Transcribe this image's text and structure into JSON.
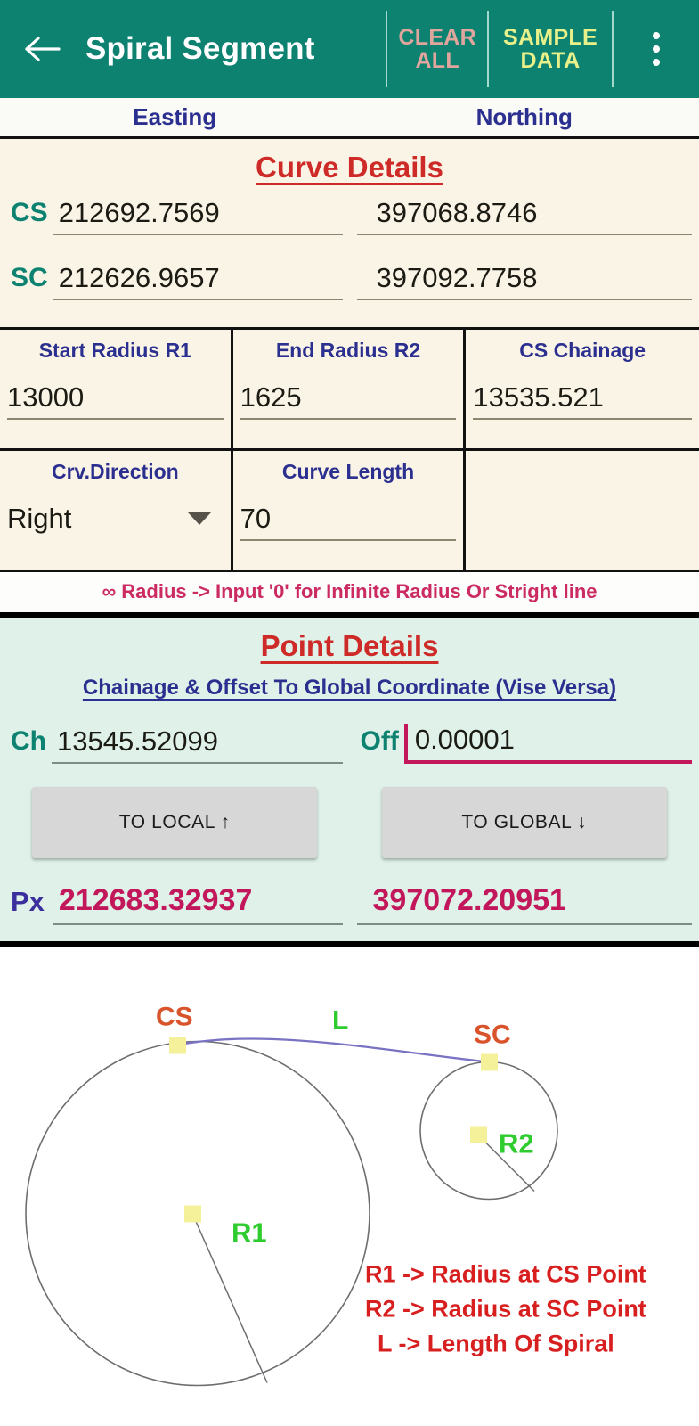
{
  "appbar": {
    "back_icon": "arrow-left-icon",
    "title": "Spiral Segment",
    "clear_all": "CLEAR\nALL",
    "clear_all_line1": "CLEAR",
    "clear_all_line2": "ALL",
    "sample_data_line1": "SAMPLE",
    "sample_data_line2": "DATA",
    "menu_icon": "overflow-menu-icon",
    "bg_color": "#0D8271",
    "clear_color": "#E0A59C",
    "sample_color": "#E8F08A"
  },
  "columns": {
    "easting": "Easting",
    "northing": "Northing"
  },
  "curve": {
    "title": "Curve Details",
    "title_color": "#CE2B28",
    "rows": [
      {
        "label": "CS",
        "easting": "212692.7569",
        "northing": "397068.8746"
      },
      {
        "label": "SC",
        "easting": "212626.9657",
        "northing": "397092.7758"
      }
    ],
    "fields": [
      {
        "label": "Start Radius R1",
        "value": "13000",
        "type": "text"
      },
      {
        "label": "End Radius R2",
        "value": "1625",
        "type": "text"
      },
      {
        "label": "CS Chainage",
        "value": "13535.521",
        "type": "text"
      },
      {
        "label": "Crv.Direction",
        "value": "Right",
        "type": "dropdown"
      },
      {
        "label": "Curve Length",
        "value": "70",
        "type": "text"
      },
      {
        "label": "",
        "value": "",
        "type": "empty"
      }
    ],
    "note": "∞ Radius -> Input '0' for Infinite Radius Or Stright line",
    "note_color": "#CB2A63"
  },
  "point": {
    "title": "Point Details",
    "subtitle": "Chainage & Offset To Global Coordinate (Vise Versa)",
    "ch_label": "Ch",
    "ch_value": "13545.52099",
    "off_label": "Off",
    "off_value": "0.00001",
    "to_local": "TO LOCAL ↑",
    "to_global": "TO GLOBAL ↓",
    "px_label": "Px",
    "px_easting": "212683.32937",
    "px_northing": "397072.20951",
    "bg_color": "#DFF1E9",
    "result_color": "#C2185B",
    "focus_color": "#C2185B"
  },
  "diagram": {
    "label_cs": "CS",
    "label_sc": "SC",
    "label_l": "L",
    "label_r1": "R1",
    "label_r2": "R2",
    "legend": [
      "R1 -> Radius at CS Point",
      "R2 -> Radius at SC Point",
      " L   -> Length Of Spiral"
    ],
    "point_marker_color": "#F5F09A",
    "circle_color": "#6E6E72",
    "spiral_color": "#7A73C4",
    "point_label_color": "#D9532B",
    "radius_label_color": "#2ECC2E",
    "legend_color": "#D81F1F"
  }
}
